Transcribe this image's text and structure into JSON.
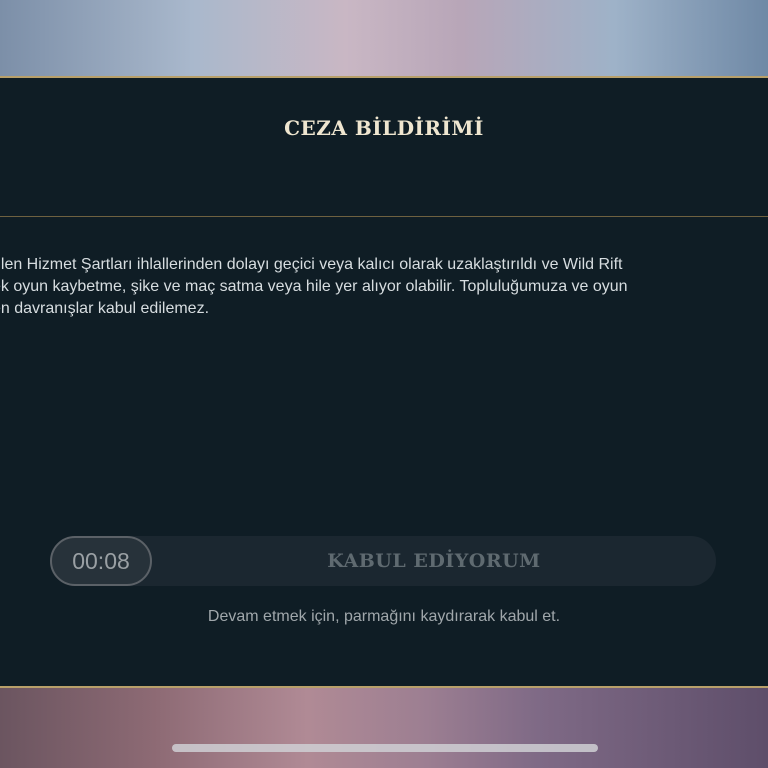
{
  "dialog": {
    "title": "CEZA BİLDİRİMİ",
    "body_lines": [
      "rilen Hizmet Şartları ihlallerinden dolayı geçici veya kalıcı olarak uzaklaştırıldı ve Wild Rift",
      "ek oyun kaybetme, şike ve maç satma veya hile yer alıyor olabilir. Topluluğumuza ve oyun",
      "en davranışlar kabul edilemez."
    ],
    "slider": {
      "timer": "00:08",
      "label": "KABUL EDİYORUM"
    },
    "hint": "Devam etmek için, parmağını kaydırarak kabul et."
  }
}
